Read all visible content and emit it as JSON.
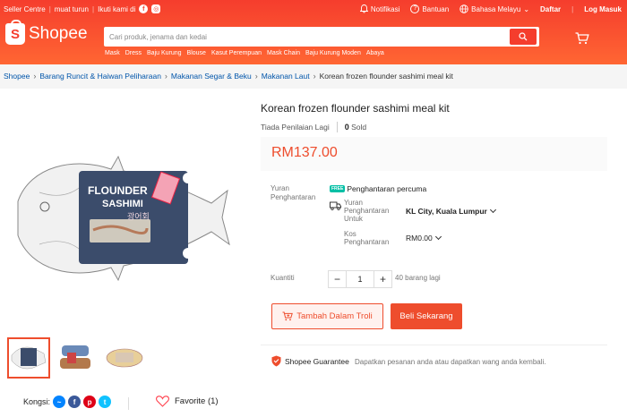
{
  "topbar": {
    "seller_centre": "Seller Centre",
    "download": "muat turun",
    "follow": "Ikuti kami di",
    "notifications": "Notifikasi",
    "help": "Bantuan",
    "language": "Bahasa Melayu",
    "register": "Daftar",
    "login": "Log Masuk"
  },
  "logo": {
    "text": "Shopee"
  },
  "search": {
    "placeholder": "Cari produk, jenama dan kedai",
    "suggestions": [
      "Mask",
      "Dress",
      "Baju Kurung",
      "Blouse",
      "Kasut Perempuan",
      "Mask Chain",
      "Baju Kurung Moden",
      "Abaya"
    ]
  },
  "breadcrumb": [
    "Shopee",
    "Barang Runcit & Haiwan Peliharaan",
    "Makanan Segar & Beku",
    "Makanan Laut",
    "Korean frozen flounder sashimi meal kit"
  ],
  "product": {
    "title": "Korean frozen flounder sashimi meal kit",
    "ratings": "Tiada Penilaian Lagi",
    "sold_count": "0",
    "sold_label": "Sold",
    "price": "RM137.00",
    "image_label_1": "FLOUNDER",
    "image_label_2": "SASHIMI",
    "image_label_korean": "광어회"
  },
  "shipping": {
    "label": "Yuran Penghantaran",
    "free_badge": "FREE",
    "free_text": "Penghantaran percuma",
    "to_label": "Yuran Penghantaran Untuk",
    "to_value": "KL City, Kuala Lumpur",
    "cost_label": "Kos Penghantaran",
    "cost_value": "RM0.00"
  },
  "quantity": {
    "label": "Kuantiti",
    "value": "1",
    "minus": "−",
    "plus": "+",
    "stock": "40 barang lagi"
  },
  "actions": {
    "add_to_cart": "Tambah Dalam Troli",
    "buy_now": "Beli Sekarang"
  },
  "guarantee": {
    "title": "Shopee Guarantee",
    "text": "Dapatkan pesanan anda atau dapatkan wang anda kembali."
  },
  "share": {
    "label": "Kongsi:"
  },
  "favorite": {
    "label": "Favorite (1)"
  },
  "colors": {
    "brand": "#ee4d2d",
    "header": "#f53d2d",
    "free_ship": "#00bfa5"
  }
}
